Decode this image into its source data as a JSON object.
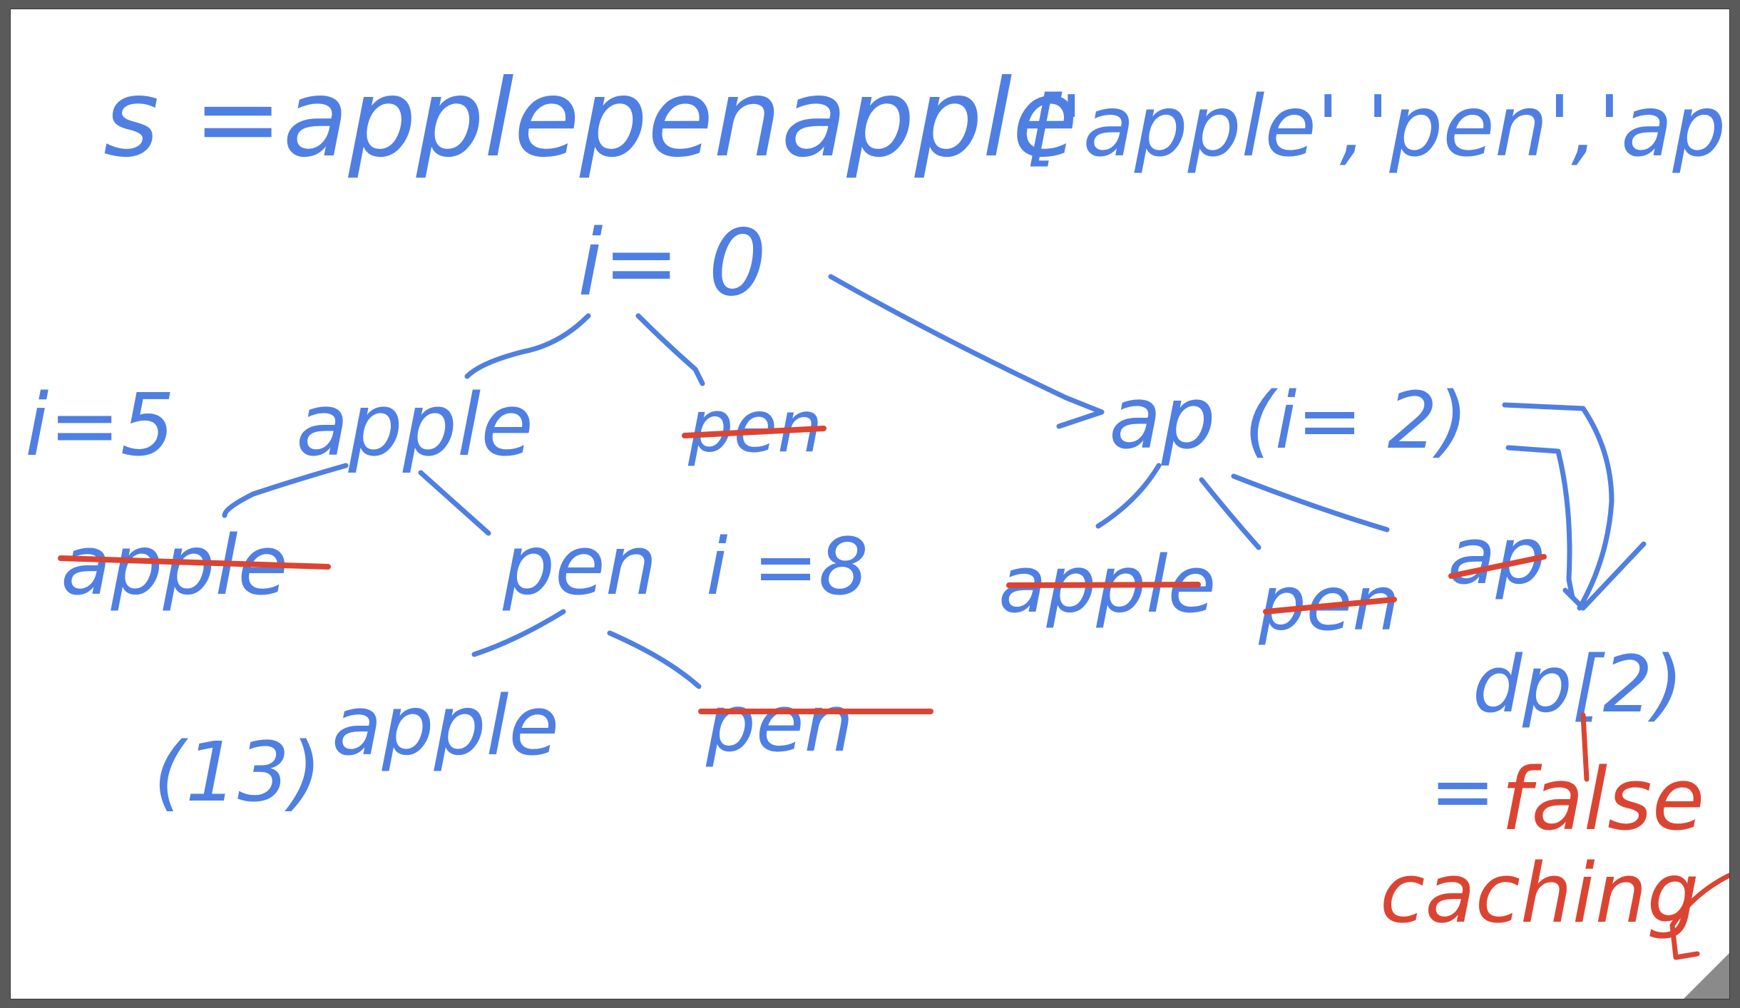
{
  "colors": {
    "ink_blue": "#4f7fe3",
    "ink_red": "#dc4432",
    "frame": "#5a5a5a",
    "paper": "#ffffff"
  },
  "header": {
    "string_def": "s =applepenapple",
    "dictionary": "['apple','pen','ap']"
  },
  "root": {
    "label": "i= 0"
  },
  "level1": {
    "apple": {
      "word": "apple",
      "index": "i=5"
    },
    "pen": {
      "word": "pen",
      "crossed": true
    },
    "ap": {
      "word": "ap",
      "index": "(i= 2)"
    }
  },
  "apple_children": {
    "apple": {
      "word": "apple",
      "crossed": true
    },
    "pen": {
      "word": "pen",
      "index": "i =8"
    }
  },
  "pen_children": {
    "apple": {
      "word": "apple",
      "index": "(13)"
    },
    "pen": {
      "word": "pen",
      "crossed": true
    }
  },
  "ap_children": {
    "apple": {
      "word": "apple",
      "crossed": true
    },
    "pen": {
      "word": "pen",
      "crossed": true
    },
    "ap": {
      "word": "ap",
      "crossed": true
    }
  },
  "memo": {
    "expression": "dp[2)",
    "equals": "=",
    "value": "false",
    "note": "caching"
  }
}
